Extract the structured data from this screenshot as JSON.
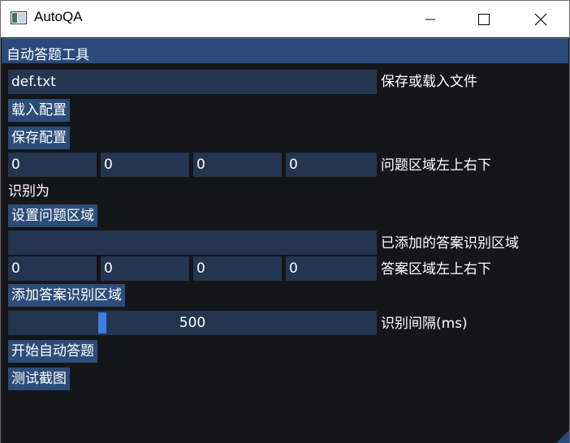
{
  "window": {
    "title": "AutoQA",
    "icons": {
      "app": "app-window-icon",
      "minimize": "minimize-icon",
      "maximize": "maximize-icon",
      "close": "close-icon"
    }
  },
  "panel": {
    "title": "自动答题工具",
    "file": {
      "value": "def.txt",
      "label": "保存或载入文件"
    },
    "load_button": "载入配置",
    "save_button": "保存配置",
    "question_region": {
      "values": [
        "0",
        "0",
        "0",
        "0"
      ],
      "label": "问题区域左上右下"
    },
    "recognized_as": "识别为",
    "set_question_region_button": "设置问题区域",
    "added_answer_regions": {
      "value": "",
      "label": "已添加的答案识别区域"
    },
    "answer_region": {
      "values": [
        "0",
        "0",
        "0",
        "0"
      ],
      "label": "答案区域左上右下"
    },
    "add_answer_region_button": "添加答案识别区域",
    "interval": {
      "value": "500",
      "label": "识别间隔(ms)",
      "fraction": 0.25
    },
    "start_button": "开始自动答题",
    "test_button": "测试截图"
  },
  "colors": {
    "background": "#15161a",
    "title_bar": "#294a7a",
    "input": "#243550",
    "button": "#2c4d79",
    "slider_grab": "#3d7ee0",
    "text": "#ffffff"
  }
}
